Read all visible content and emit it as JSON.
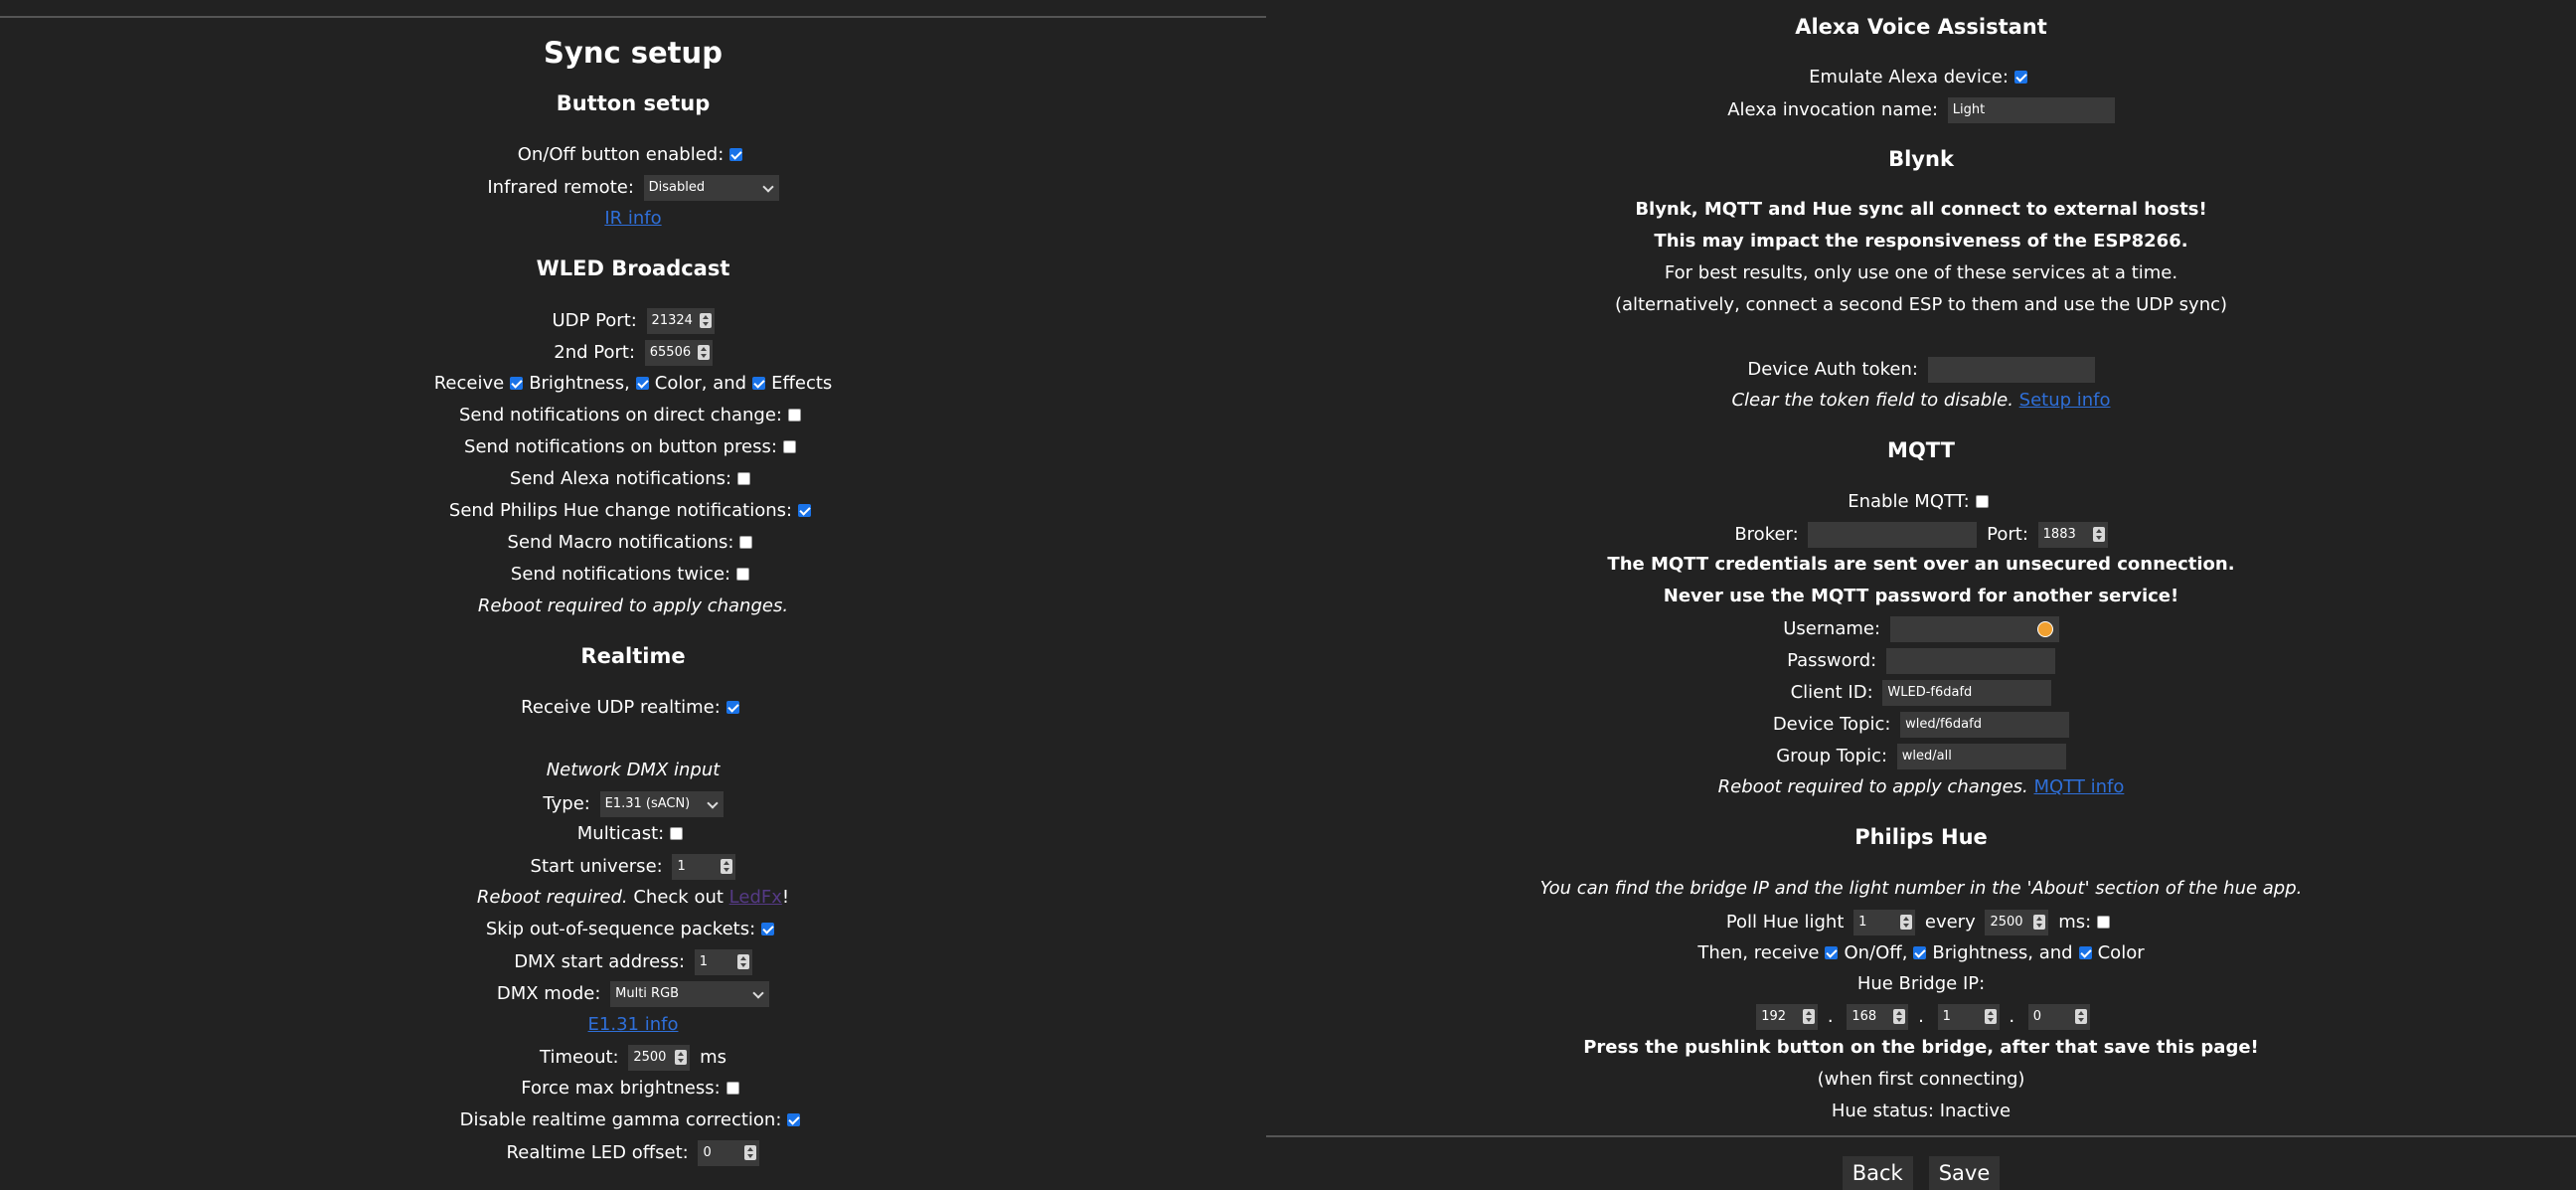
{
  "left": {
    "title": "Sync setup",
    "button_setup": {
      "heading": "Button setup",
      "onoff_label": "On/Off button enabled:",
      "onoff_checked": true,
      "ir_label": "Infrared remote:",
      "ir_value": "Disabled",
      "ir_link": "IR info"
    },
    "broadcast": {
      "heading": "WLED Broadcast",
      "udp_port_label": "UDP Port:",
      "udp_port": "21324",
      "port2_label": "2nd Port:",
      "port2": "65506",
      "receive_label": "Receive",
      "brightness_label": "Brightness,",
      "color_label": "Color, and",
      "effects_label": "Effects",
      "notif_direct": "Send notifications on direct change:",
      "notif_button": "Send notifications on button press:",
      "notif_alexa": "Send Alexa notifications:",
      "notif_hue": "Send Philips Hue change notifications:",
      "notif_macro": "Send Macro notifications:",
      "notif_twice": "Send notifications twice:",
      "reboot": "Reboot required to apply changes."
    },
    "realtime": {
      "heading": "Realtime",
      "receive_udp_label": "Receive UDP realtime:",
      "dmx_heading": "Network DMX input",
      "type_label": "Type:",
      "type_value": "E1.31 (sACN)",
      "multicast_label": "Multicast:",
      "start_universe_label": "Start universe:",
      "start_universe": "1",
      "reboot_prefix": "Reboot required.",
      "check_out": " Check out ",
      "ledfx_link": "LedFx",
      "exclaim": "!",
      "skip_label": "Skip out-of-sequence packets:",
      "dmx_start_label": "DMX start address:",
      "dmx_start": "1",
      "dmx_mode_label": "DMX mode:",
      "dmx_mode": "Multi RGB",
      "e131_link": "E1.31 info",
      "timeout_label": "Timeout:",
      "timeout": "2500",
      "timeout_unit": "ms",
      "force_max_label": "Force max brightness:",
      "gamma_label": "Disable realtime gamma correction:",
      "led_offset_label": "Realtime LED offset:",
      "led_offset": "0"
    }
  },
  "right": {
    "alexa": {
      "heading": "Alexa Voice Assistant",
      "emulate_label": "Emulate Alexa device:",
      "invocation_label": "Alexa invocation name:",
      "invocation_value": "Light"
    },
    "blynk": {
      "heading": "Blynk",
      "warn1": "Blynk, MQTT and Hue sync all connect to external hosts!",
      "warn2": "This may impact the responsiveness of the ESP8266.",
      "note1": "For best results, only use one of these services at a time.",
      "note2": "(alternatively, connect a second ESP to them and use the UDP sync)",
      "token_label": "Device Auth token:",
      "token_value": "",
      "clear_note": "Clear the token field to disable. ",
      "setup_link": "Setup info"
    },
    "mqtt": {
      "heading": "MQTT",
      "enable_label": "Enable MQTT:",
      "broker_label": "Broker:",
      "broker_value": "",
      "port_label": "Port:",
      "port_value": "1883",
      "warn1": "The MQTT credentials are sent over an unsecured connection.",
      "warn2": "Never use the MQTT password for another service!",
      "username_label": "Username:",
      "password_label": "Password:",
      "client_label": "Client ID:",
      "client_value": "WLED-f6dafd",
      "device_topic_label": "Device Topic:",
      "device_topic": "wled/f6dafd",
      "group_topic_label": "Group Topic:",
      "group_topic": "wled/all",
      "reboot": "Reboot required to apply changes. ",
      "mqtt_link": "MQTT info"
    },
    "hue": {
      "heading": "Philips Hue",
      "hint": "You can find the bridge IP and the light number in the 'About' section of the hue app.",
      "poll_label": "Poll Hue light",
      "poll_light": "1",
      "every_label": "every",
      "every_value": "2500",
      "ms_label": "ms:",
      "then_receive": "Then, receive",
      "onoff_label": "On/Off,",
      "brightness_label": "Brightness, and",
      "color_label": "Color",
      "bridge_label": "Hue Bridge IP:",
      "ip": [
        "192",
        "168",
        "1",
        "0"
      ],
      "dot": ".",
      "pushlink": "Press the pushlink button on the bridge, after that save this page!",
      "first_connect": "(when first connecting)",
      "status": "Hue status: Inactive"
    },
    "footer": {
      "back": "Back",
      "save": "Save"
    }
  }
}
